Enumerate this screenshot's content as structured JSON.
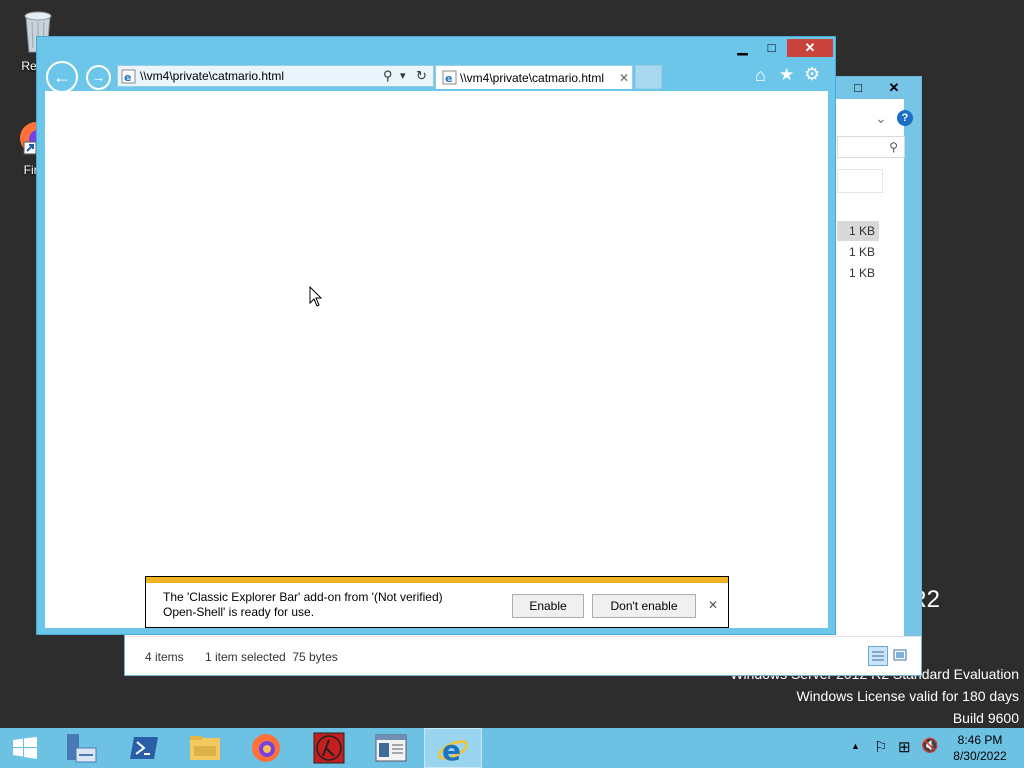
{
  "desktop": {
    "icons": [
      {
        "label": "Recyc"
      },
      {
        "label": "Fire"
      }
    ],
    "watermark": {
      "partial": "R2",
      "line1": "Windows Server 2012 R2 Standard Evaluation",
      "line2": "Windows License valid for 180 days",
      "line3": "Build 9600"
    }
  },
  "explorer": {
    "status_items": "4 items",
    "status_selected": "1 item selected  75 bytes",
    "file_sizes": [
      "1 KB",
      "1 KB",
      "1 KB"
    ],
    "controls": {
      "maximize": "□",
      "close": "✕",
      "help": "?",
      "chevron": "⌄",
      "search": "⚲"
    }
  },
  "ie": {
    "address": "\\\\vm4\\private\\catmario.html",
    "tab_title": "\\\\vm4\\private\\catmario.html",
    "tab_close": "✕",
    "caption": {
      "minimize": "▁",
      "maximize": "□",
      "close": "✕"
    },
    "nav": {
      "back": "←",
      "forward": "→"
    },
    "addr_tools": {
      "search": "⚲",
      "dropdown": "▾",
      "refresh": "↻"
    },
    "toolbar": {
      "home": "⌂",
      "favorites": "★",
      "settings": "⚙"
    },
    "notification": {
      "line1": "The 'Classic Explorer Bar' add-on from '(Not verified)",
      "line2": "Open-Shell' is ready for use.",
      "enable": "Enable",
      "dont_enable": "Don't enable",
      "close": "✕"
    }
  },
  "taskbar": {
    "time": "8:46 PM",
    "date": "8/30/2022",
    "tray": {
      "show_hidden": "▲",
      "flag": "⚐",
      "network": "⊞",
      "volume": "🔇"
    }
  }
}
